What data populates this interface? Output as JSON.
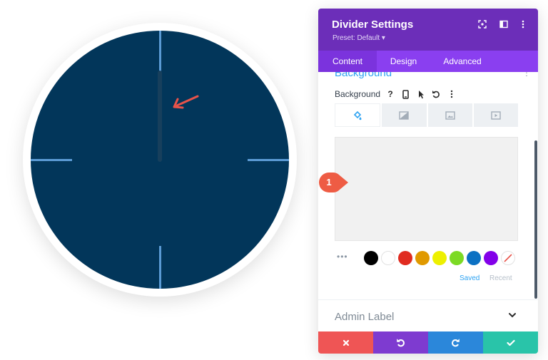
{
  "panel": {
    "title": "Divider Settings",
    "preset": "Preset: Default ▾",
    "header_icons": [
      "focus-icon",
      "split-view-icon",
      "more-vertical-icon"
    ]
  },
  "tabs": [
    {
      "label": "Content",
      "active": true
    },
    {
      "label": "Design",
      "active": false
    },
    {
      "label": "Advanced",
      "active": false
    }
  ],
  "background": {
    "section_title": "Background",
    "row_label": "Background",
    "help_label": "?",
    "type_tabs": [
      "color-fill-icon",
      "gradient-icon",
      "image-icon",
      "video-icon"
    ],
    "swatches": [
      "#000000",
      "#ffffff",
      "#e02b20",
      "#e09900",
      "#edf000",
      "#7cda24",
      "#0c71c3",
      "#8300e9"
    ],
    "saved_label": "Saved",
    "recent_label": "Recent"
  },
  "admin_label": "Admin Label",
  "callout_number": "1",
  "colors": {
    "header": "#6c2eb9",
    "tabs": "#8a3ff0",
    "clock_face": "#02365a",
    "tick": "#5b9bd5",
    "cancel": "#ef5555",
    "undo": "#7e3bd0",
    "redo": "#2b87da",
    "save": "#29c4a9"
  }
}
